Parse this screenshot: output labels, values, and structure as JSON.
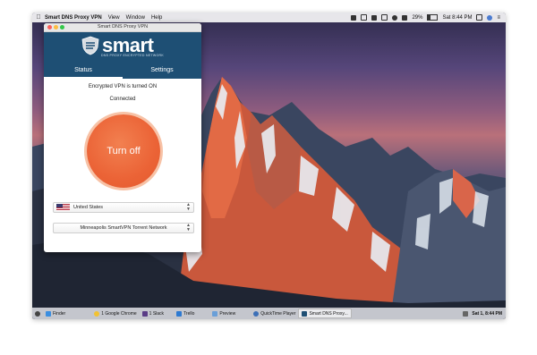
{
  "menubar": {
    "app_name": "Smart DNS Proxy VPN",
    "items": [
      "View",
      "Window",
      "Help"
    ],
    "battery": "29%",
    "clock": "Sat 8:44 PM"
  },
  "window": {
    "title": "Smart DNS Proxy VPN",
    "logo_text": "smart",
    "logo_tagline": "DNS PROXY ENCRYPTED NETWORK",
    "tabs": [
      "Status",
      "Settings"
    ],
    "status_text": "Encrypted VPN is turned ON",
    "connection_text": "Connected",
    "power_button_label": "Turn off",
    "country": "United States",
    "server": "Minneapolis  SmartVPN Torrent Network"
  },
  "dock": {
    "apps": [
      "Finder",
      "1 Google Chrome",
      "1 Slack",
      "Trello",
      "Preview",
      "QuickTime Player",
      "Smart DNS Proxy..."
    ],
    "active_app": "Smart DNS Proxy...",
    "clock": "Sat 1, 8:44 PM"
  },
  "colors": {
    "header_blue": "#1e4f74",
    "power_orange": "#eb6336",
    "app_icons": [
      "#3b8ee0",
      "#f2c232",
      "#5a3c86",
      "#2e7ad1",
      "#6a9fd8",
      "#3c6fb7",
      "#1e4f74"
    ]
  },
  "icons": [
    "apple-icon",
    "shield-icon",
    "wifi-icon",
    "volume-icon",
    "battery-icon",
    "search-icon",
    "siri-icon",
    "menu-icon",
    "flag-us-icon",
    "chevron-updown-icon",
    "trash-icon"
  ]
}
